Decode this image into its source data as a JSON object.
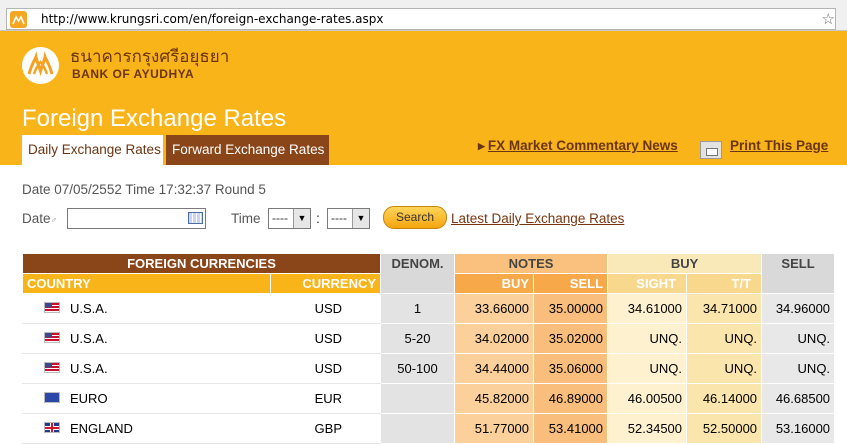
{
  "browser": {
    "url": "http://www.krungsri.com/en/foreign-exchange-rates.aspx"
  },
  "header": {
    "logo_thai": "ธนาคารกรุงศรีอยุธยา",
    "logo_english": "BANK OF AYUDHYA",
    "page_title": "Foreign Exchange Rates",
    "tabs": [
      {
        "label": "Daily Exchange Rates",
        "active": true
      },
      {
        "label": "Forward Exchange Rates",
        "active": false
      }
    ],
    "fx_commentary_link": "FX Market Commentary News",
    "print_link": "Print This Page"
  },
  "form": {
    "date_info": "Date 07/05/2552 Time 17:32:37 Round 5",
    "date_label": "Date",
    "date_value": "",
    "time_label": "Time",
    "hour_value": "----",
    "minute_value": "----",
    "colon": ":",
    "search_label": "Search",
    "latest_link": "Latest Daily Exchange Rates"
  },
  "table": {
    "headers": {
      "foreign_currencies": "FOREIGN CURRENCIES",
      "denom": "DENOM.",
      "notes": "NOTES",
      "buy": "BUY",
      "sell": "SELL",
      "country": "COUNTRY",
      "currency": "CURRENCY",
      "notes_buy": "BUY",
      "notes_sell": "SELL",
      "sight": "SIGHT",
      "tt": "T/T"
    },
    "rows": [
      {
        "flag": "us-flag-icon",
        "country": "U.S.A.",
        "currency": "USD",
        "denom": "1",
        "notes_buy": "33.66000",
        "notes_sell": "35.00000",
        "sight": "34.61000",
        "tt": "34.71000",
        "sell": "34.96000"
      },
      {
        "flag": "us-flag-icon",
        "country": "U.S.A.",
        "currency": "USD",
        "denom": "5-20",
        "notes_buy": "34.02000",
        "notes_sell": "35.02000",
        "sight": "UNQ.",
        "tt": "UNQ.",
        "sell": "UNQ."
      },
      {
        "flag": "us-flag-icon",
        "country": "U.S.A.",
        "currency": "USD",
        "denom": "50-100",
        "notes_buy": "34.44000",
        "notes_sell": "35.06000",
        "sight": "UNQ.",
        "tt": "UNQ.",
        "sell": "UNQ."
      },
      {
        "flag": "eu-flag-icon",
        "country": "EURO",
        "currency": "EUR",
        "denom": "",
        "notes_buy": "45.82000",
        "notes_sell": "46.89000",
        "sight": "46.00500",
        "tt": "46.14000",
        "sell": "46.68500"
      },
      {
        "flag": "gb-flag-icon",
        "country": "ENGLAND",
        "currency": "GBP",
        "denom": "",
        "notes_buy": "51.77000",
        "notes_sell": "53.41000",
        "sight": "52.34500",
        "tt": "52.50000",
        "sell": "53.16000"
      }
    ]
  },
  "colors": {
    "brand_orange": "#f9b41a",
    "brand_brown": "#8a4519",
    "link_brown": "#6b3511"
  }
}
